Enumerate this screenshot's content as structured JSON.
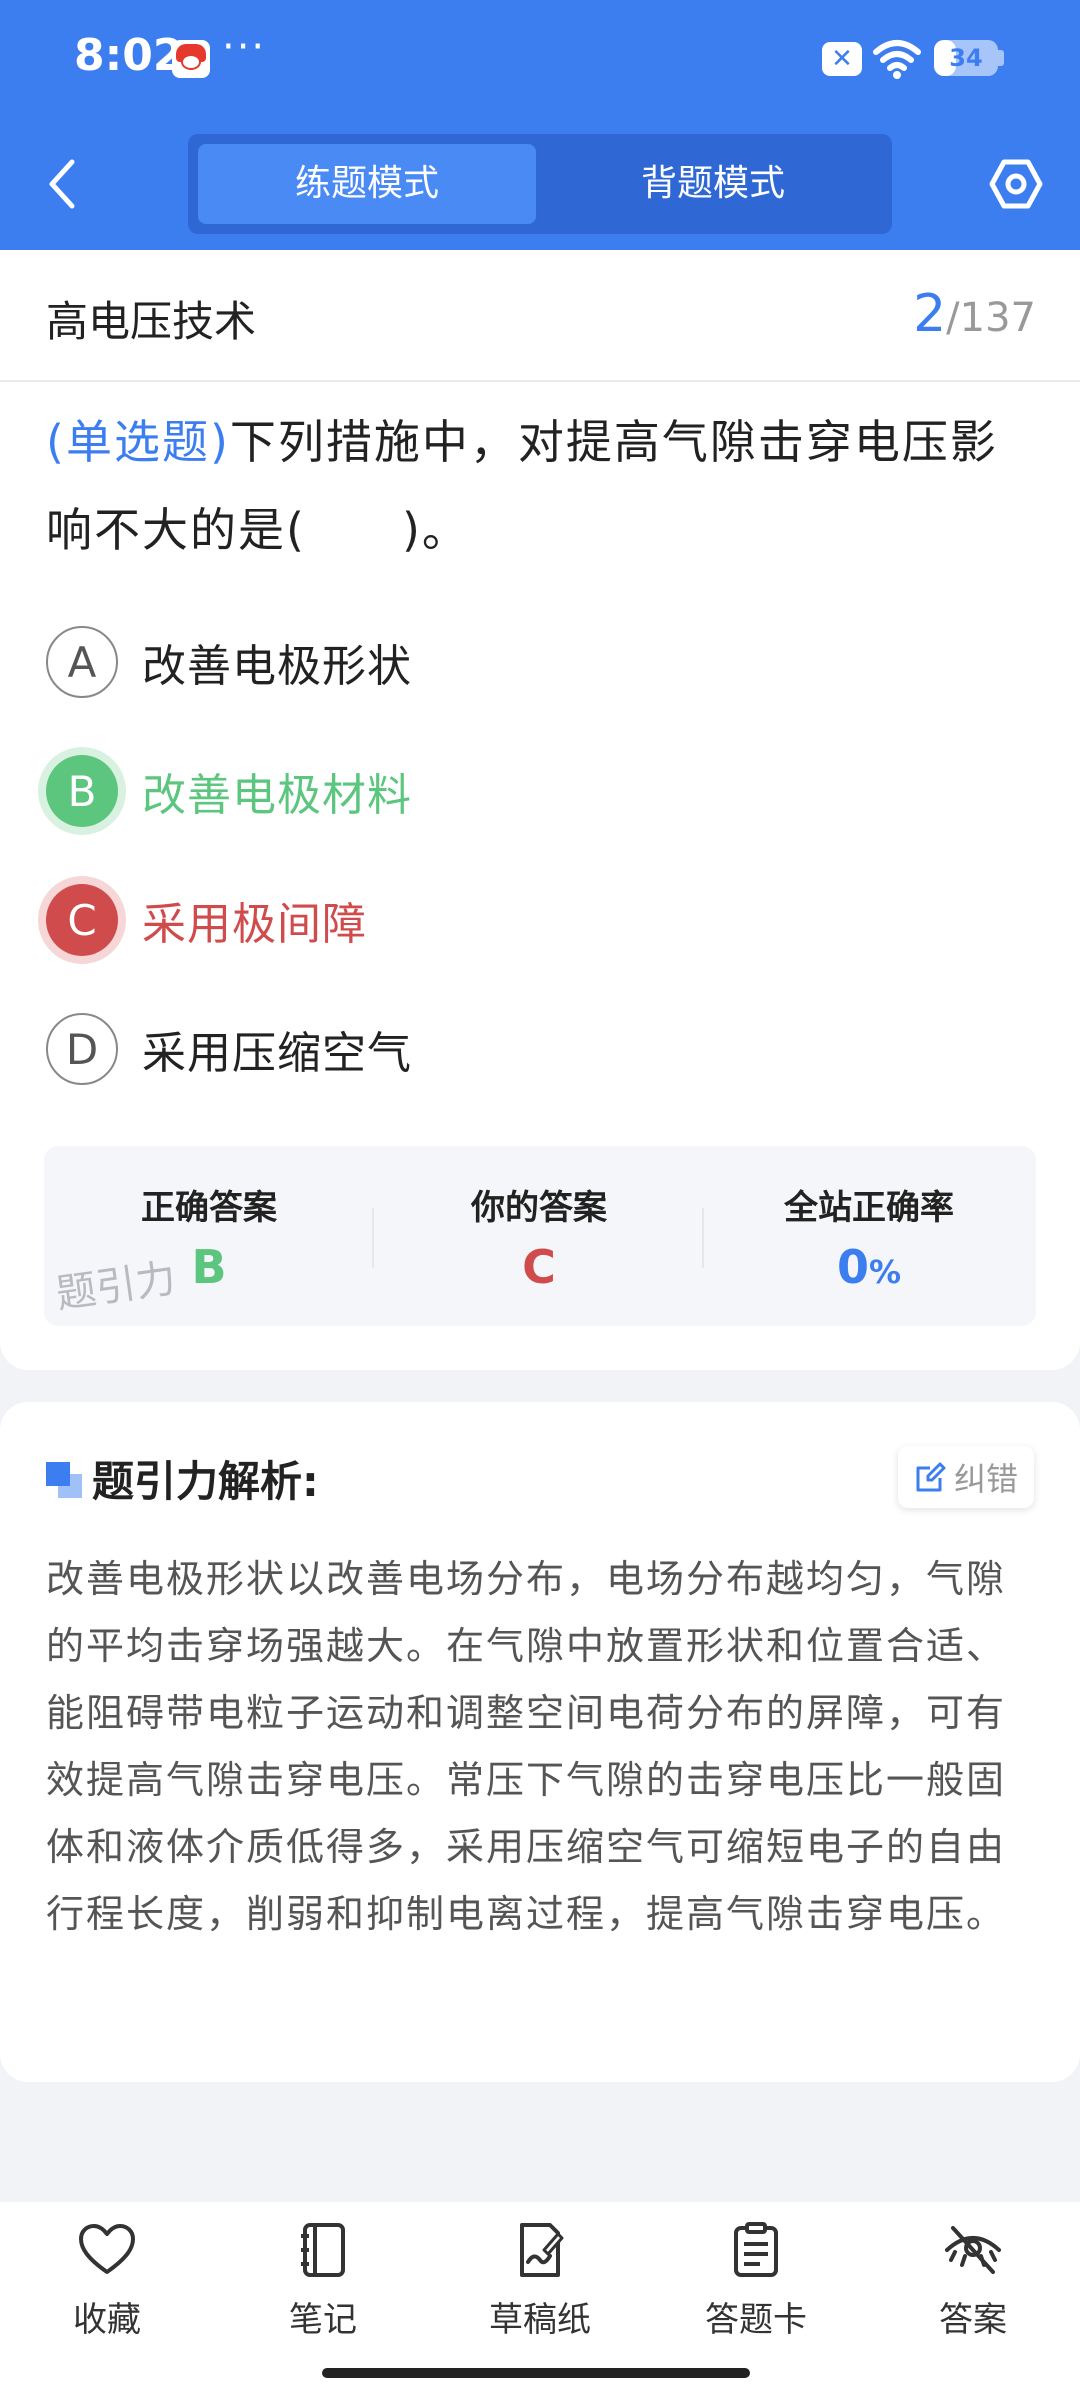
{
  "status_bar": {
    "time": "8:02",
    "more": "···",
    "battery": "34",
    "battery_level": 0.34,
    "icons": [
      "app-badge-icon",
      "x-icon",
      "wifi-icon",
      "battery-icon"
    ]
  },
  "header": {
    "modes": [
      "练题模式",
      "背题模式"
    ],
    "active_mode": "练题模式",
    "accent_color": "#3c7ef0",
    "icons": [
      "back-icon",
      "settings-icon"
    ]
  },
  "subject": {
    "title": "高电压技术",
    "current": "2",
    "total": "/137"
  },
  "question": {
    "tag": "(单选题)",
    "text": "下列措施中，对提高气隙击穿电压影响不大的是(　　)。"
  },
  "options": [
    {
      "letter": "A",
      "text": "改善电极形状",
      "state": "normal"
    },
    {
      "letter": "B",
      "text": "改善电极材料",
      "state": "correct"
    },
    {
      "letter": "C",
      "text": "采用极间障",
      "state": "wrong"
    },
    {
      "letter": "D",
      "text": "采用压缩空气",
      "state": "normal"
    }
  ],
  "stats": {
    "correct_label": "正确答案",
    "correct_value": "B",
    "yours_label": "你的答案",
    "yours_value": "C",
    "rate_label": "全站正确率",
    "rate_value": "0",
    "rate_unit": "%",
    "watermark": "题引力",
    "colors": {
      "correct": "#5cc57e",
      "wrong": "#d04c4c",
      "rate": "#3c7ef0"
    }
  },
  "analysis": {
    "title": "题引力解析:",
    "report_label": "纠错",
    "text": "改善电极形状以改善电场分布，电场分布越均匀，气隙的平均击穿场强越大。在气隙中放置形状和位置合适、能阻碍带电粒子运动和调整空间电荷分布的屏障，可有效提高气隙击穿电压。常压下气隙的击穿电压比一般固体和液体介质低得多，采用压缩空气可缩短电子的自由行程长度，削弱和抑制电离过程，提高气隙击穿电压。"
  },
  "toolbar": {
    "items": [
      {
        "label": "收藏",
        "icon": "heart-icon"
      },
      {
        "label": "笔记",
        "icon": "notebook-icon"
      },
      {
        "label": "草稿纸",
        "icon": "draft-paper-icon"
      },
      {
        "label": "答题卡",
        "icon": "answer-card-icon"
      },
      {
        "label": "答案",
        "icon": "eye-off-icon"
      }
    ]
  }
}
